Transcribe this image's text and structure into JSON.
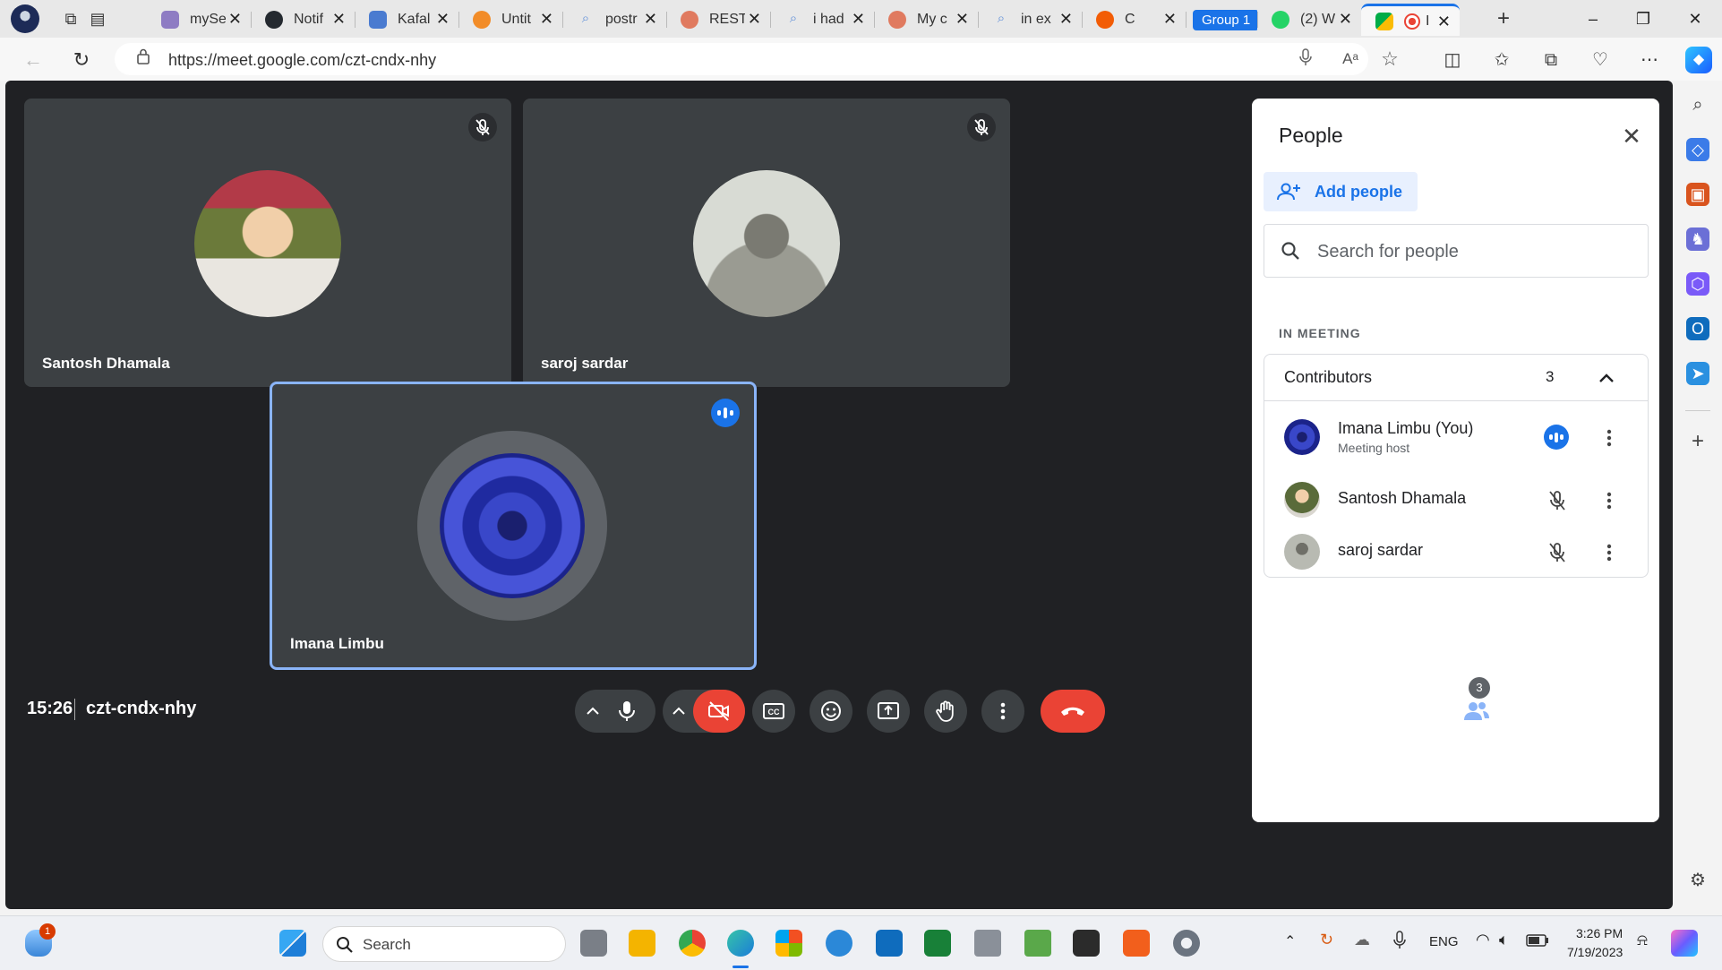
{
  "browser": {
    "tabs": [
      {
        "title": "mySe",
        "color": "#8e7cc3"
      },
      {
        "title": "Notif",
        "color": "#24292f"
      },
      {
        "title": "Kafal",
        "color": "#4a7bd0"
      },
      {
        "title": "Untit",
        "color": "#f28c28"
      },
      {
        "title": "postr",
        "color": "#5f8fd9"
      },
      {
        "title": "REST",
        "color": "#e07a5f"
      },
      {
        "title": "i had",
        "color": "#5f8fd9"
      },
      {
        "title": "My c",
        "color": "#e07a5f"
      },
      {
        "title": "in ex",
        "color": "#5f8fd9"
      },
      {
        "title": "C",
        "color": "#f25c05"
      }
    ],
    "group_label": "Group 1",
    "grouped_tabs": [
      {
        "title": "(2) W",
        "color": "#25d366"
      },
      {
        "title": "I",
        "color": "#ea4335"
      }
    ],
    "url": "https://meet.google.com/czt-cndx-nhy"
  },
  "meet": {
    "participants": [
      {
        "name": "Santosh Dhamala",
        "muted": true
      },
      {
        "name": "saroj sardar",
        "muted": true
      },
      {
        "name": "Imana Limbu",
        "speaking": true
      }
    ],
    "time": "15:26",
    "code": "czt-cndx-nhy",
    "people_count": "3"
  },
  "people_panel": {
    "title": "People",
    "add_people": "Add people",
    "search_placeholder": "Search for people",
    "section": "IN MEETING",
    "group": "Contributors",
    "group_count": "3",
    "members": [
      {
        "name": "Imana Limbu (You)",
        "role": "Meeting host",
        "state": "speaking"
      },
      {
        "name": "Santosh Dhamala",
        "role": "",
        "state": "muted"
      },
      {
        "name": "saroj sardar",
        "role": "",
        "state": "muted"
      }
    ]
  },
  "taskbar": {
    "search": "Search",
    "weather_badge": "1",
    "lang": "ENG",
    "clock_time": "3:26 PM",
    "clock_date": "7/19/2023"
  },
  "colors": {
    "meet_bg": "#202124",
    "tile_bg": "#3c4043",
    "accent": "#1a73e8",
    "hangup": "#ea4335"
  }
}
